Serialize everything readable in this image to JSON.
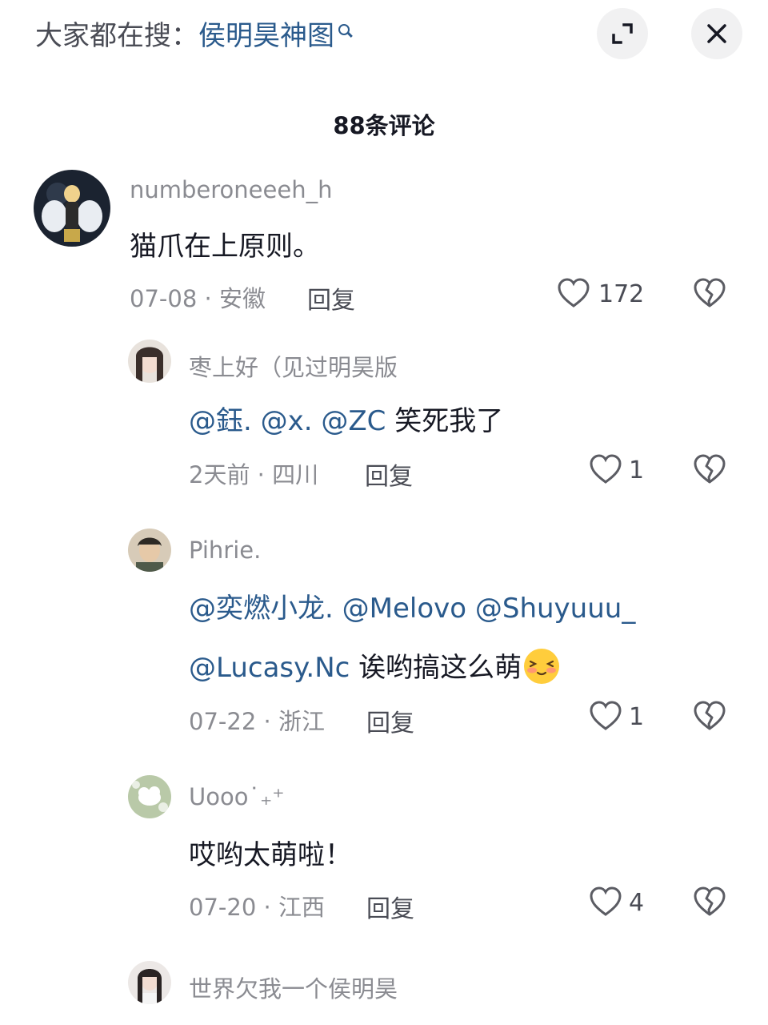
{
  "header": {
    "search_prefix": "大家都在搜：",
    "search_term": "侯明昊神图",
    "expand_icon": "expand-icon",
    "close_icon": "close-icon"
  },
  "comments_title": "88条评论",
  "comments": [
    {
      "username": "numberoneeeh_h",
      "text": "猫爪在上原则。",
      "time": "07-08",
      "location": "安徽",
      "reply_label": "回复",
      "likes": "172"
    },
    {
      "username": "枣上好（见过明昊版",
      "mentions": [
        "@鈺.",
        "@x.",
        "@ZC"
      ],
      "text": "笑死我了",
      "time": "2天前",
      "location": "四川",
      "reply_label": "回复",
      "likes": "1"
    },
    {
      "username": "Pihrie.",
      "mentions": [
        "@奕燃小龙.",
        "@Melovo",
        "@Shuyuuu_",
        "@Lucasy.Nc"
      ],
      "text": "诶哟搞这么萌",
      "emoji": "shy-smile-emoji",
      "time": "07-22",
      "location": "浙江",
      "reply_label": "回复",
      "likes": "1"
    },
    {
      "username": "Uooo˙₊⁺",
      "text": "哎哟太萌啦！",
      "time": "07-20",
      "location": "江西",
      "reply_label": "回复",
      "likes": "4"
    },
    {
      "username": "世界欠我一个侯明昊"
    }
  ],
  "icons": {
    "like": "heart-icon",
    "dislike": "broken-heart-icon"
  },
  "colors": {
    "mention": "#2a5a8c",
    "secondary_text": "#8a8b91",
    "primary_text": "#161823",
    "button_bg": "#f1f1f2"
  }
}
